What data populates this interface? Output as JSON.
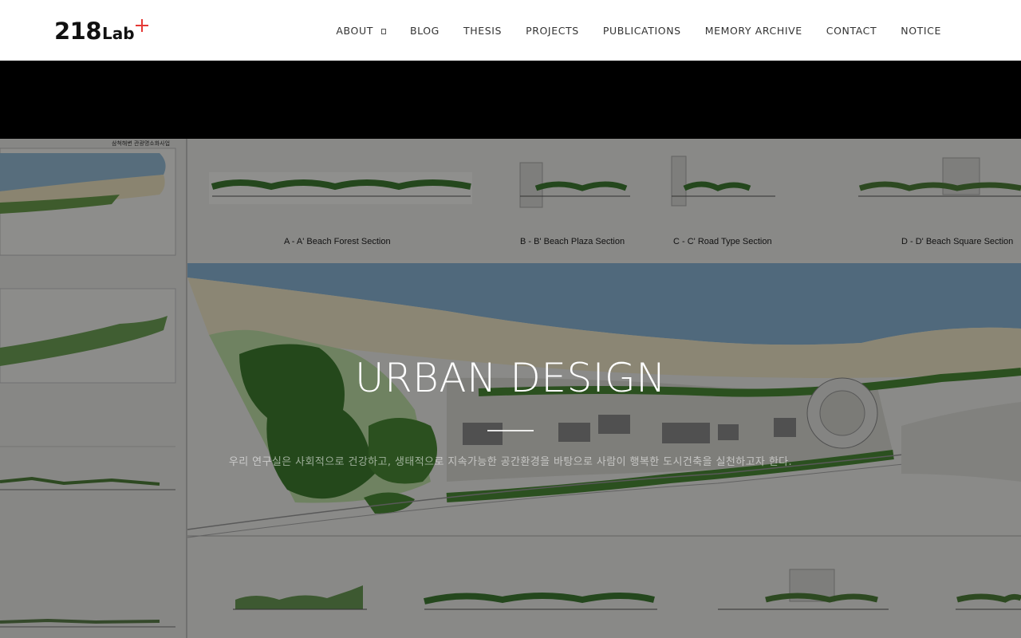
{
  "site": {
    "logo": {
      "number": "218",
      "text": "Lab",
      "plus_color": "#e53935"
    }
  },
  "nav": {
    "items": [
      {
        "label": "ABOUT",
        "has_dropdown": true
      },
      {
        "label": "BLOG"
      },
      {
        "label": "THESIS"
      },
      {
        "label": "PROJECTS"
      },
      {
        "label": "PUBLICATIONS"
      },
      {
        "label": "MEMORY ARCHIVE"
      },
      {
        "label": "CONTACT"
      },
      {
        "label": "NOTICE"
      }
    ]
  },
  "hero": {
    "title": "URBAN DESIGN",
    "subtitle": "우리 연구실은 사회적으로 건강하고, 생태적으로 지속가능한 공간환경을 바탕으로 사람이 행복한 도시건축을 실천하고자 한다.",
    "drawing": {
      "sections": [
        "A - A' Beach Forest Section",
        "B - B' Beach Plaza Section",
        "C - C' Road Type Section",
        "D - D' Beach Square Section"
      ],
      "panel_title": "삼척해변 관광명소화사업"
    },
    "colors": {
      "sea": "#8ab6d6",
      "sand": "#efe7c8",
      "trees": "#4f8f3a",
      "overlay": "rgba(0,0,0,0.42)"
    }
  }
}
